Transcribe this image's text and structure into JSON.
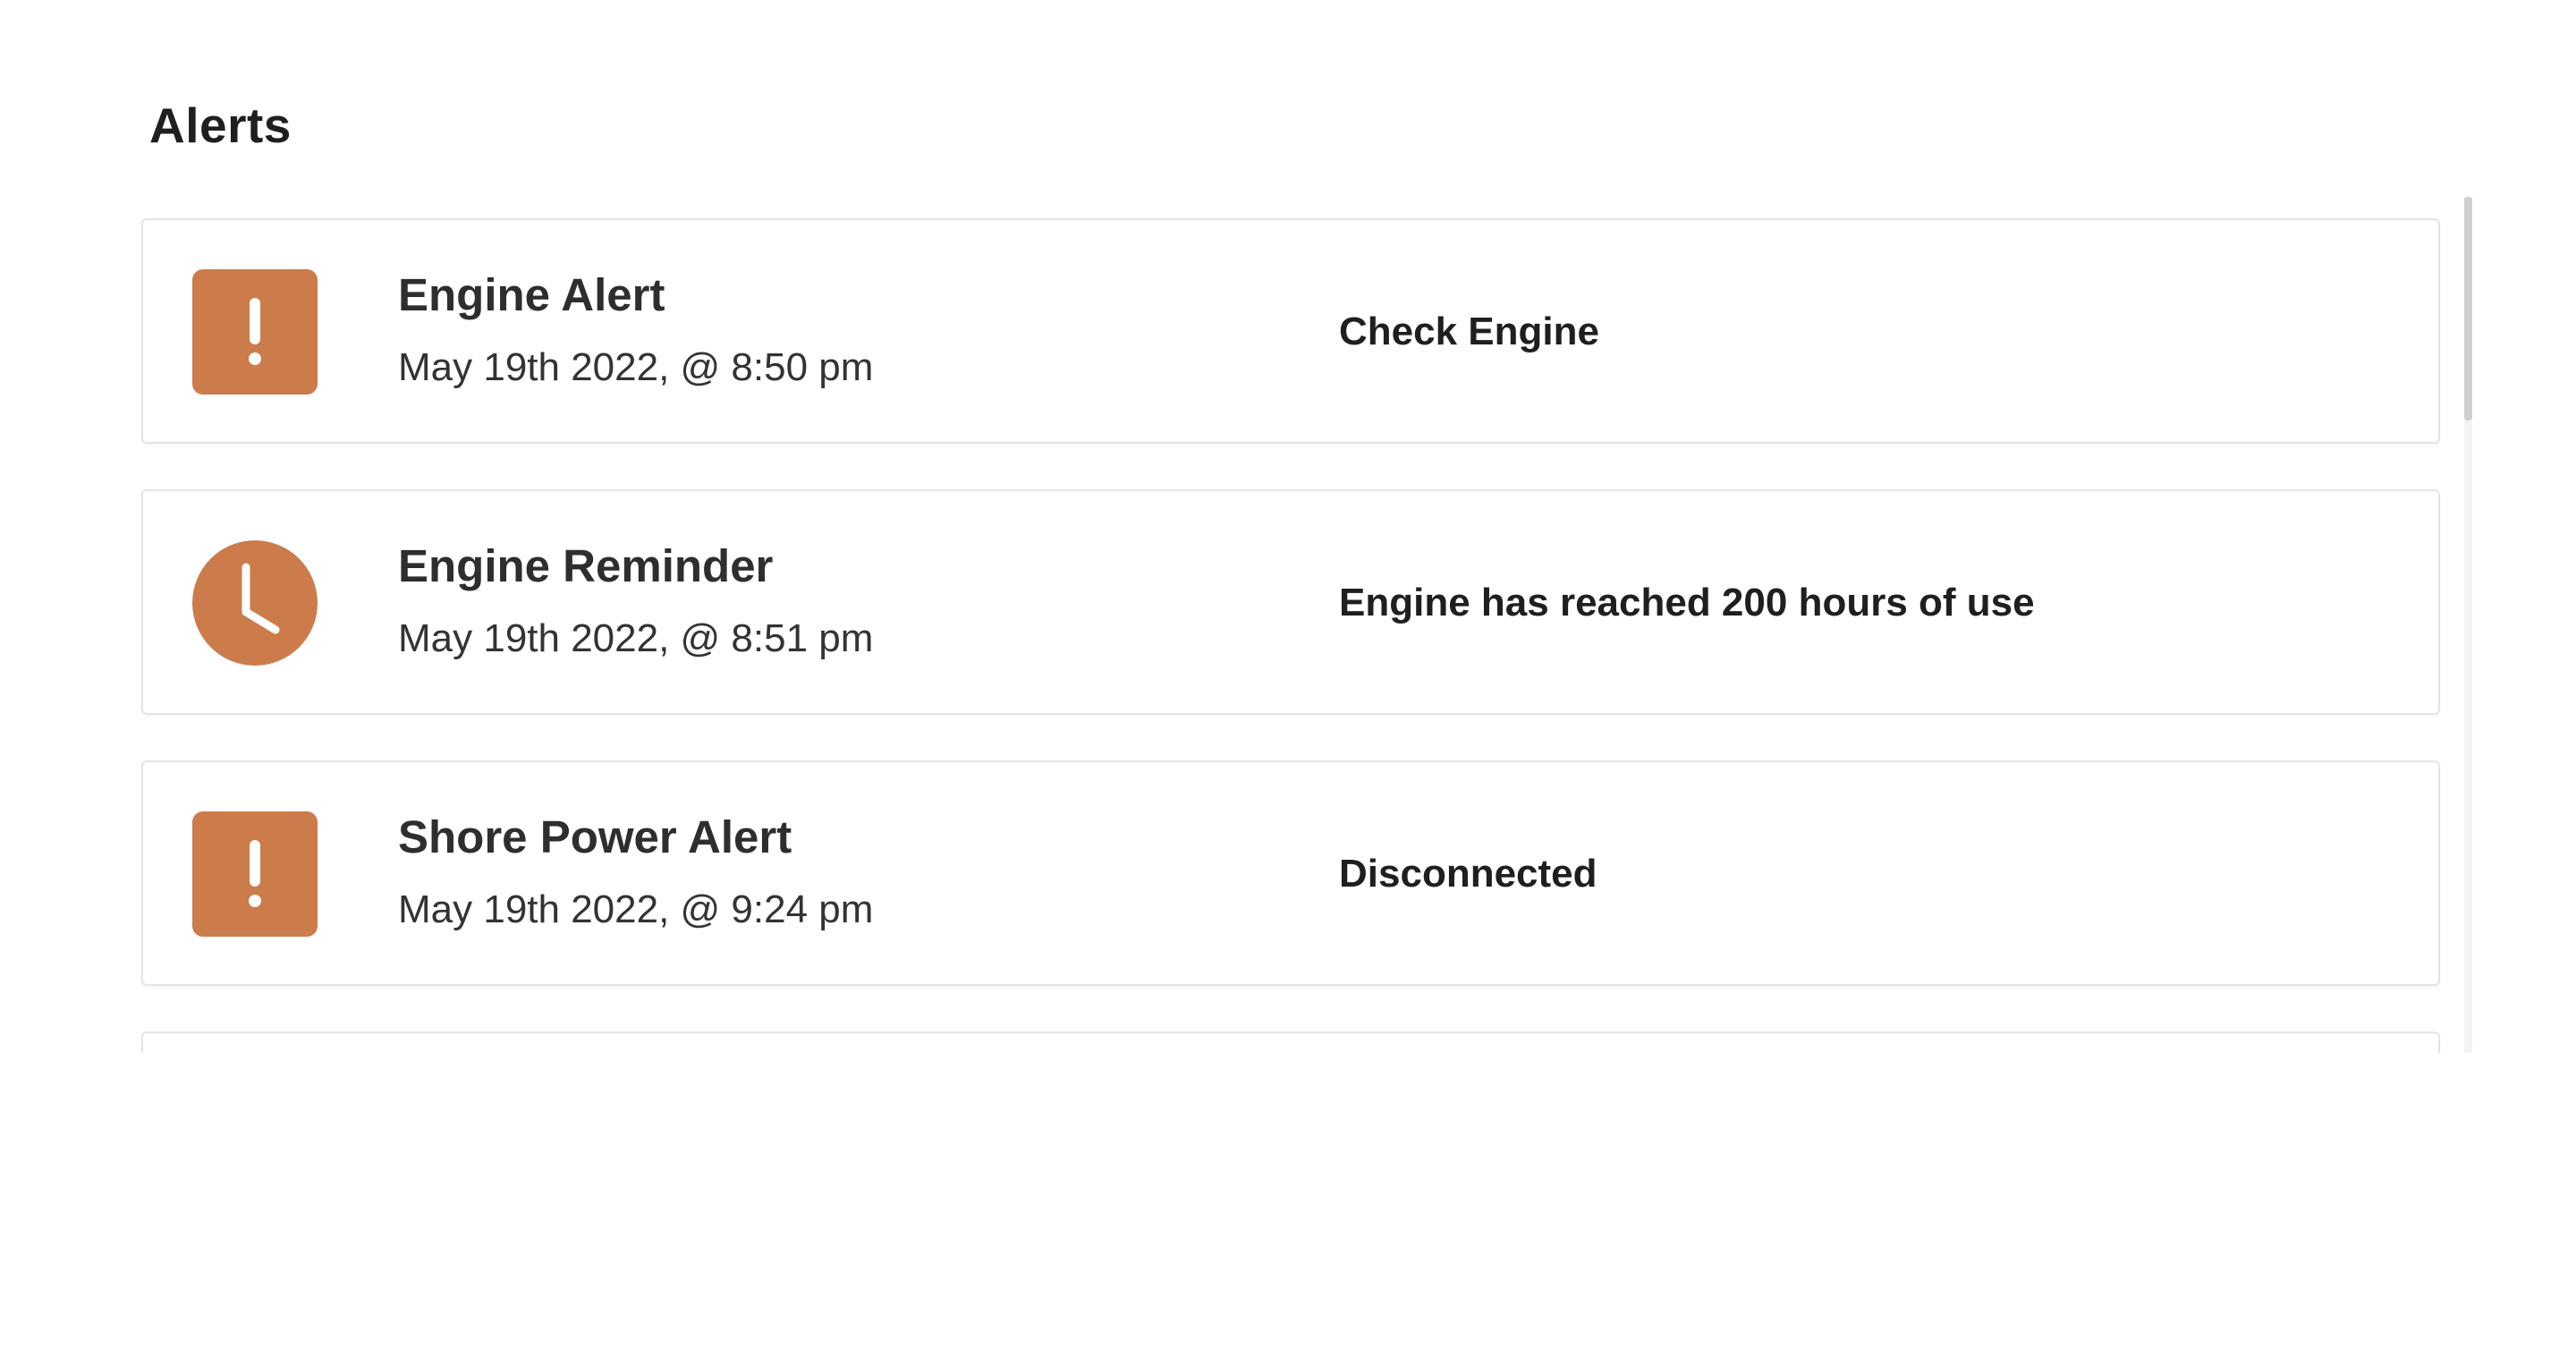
{
  "page": {
    "title": "Alerts"
  },
  "alerts": [
    {
      "icon": "exclamation-icon",
      "title": "Engine Alert",
      "time": "May 19th 2022, @ 8:50 pm",
      "message": "Check Engine"
    },
    {
      "icon": "clock-icon",
      "title": "Engine Reminder",
      "time": "May 19th 2022, @ 8:51 pm",
      "message": "Engine has reached 200 hours of use"
    },
    {
      "icon": "exclamation-icon",
      "title": "Shore Power Alert",
      "time": "May 19th 2022, @ 9:24 pm",
      "message": "Disconnected"
    }
  ],
  "colors": {
    "accent": "#cc7b4b",
    "border": "#e4e4e4",
    "text": "#2e2e2e"
  }
}
